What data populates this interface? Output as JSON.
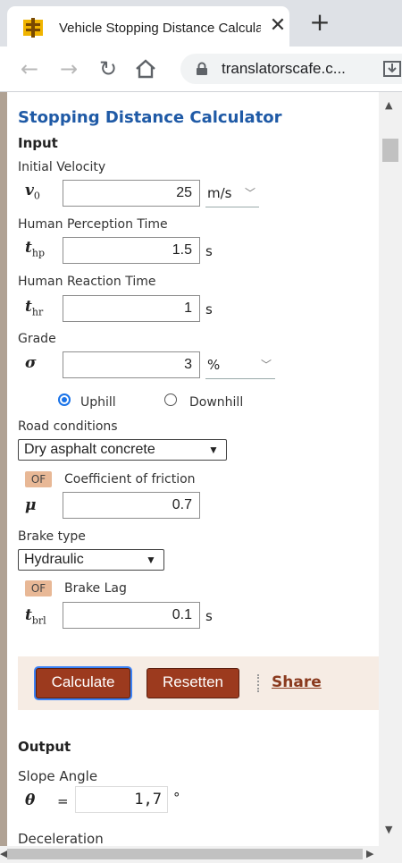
{
  "browser": {
    "tab_title": "Vehicle Stopping Distance Calculator",
    "tab_close": "✕",
    "new_tab": "+",
    "url": "translatorscafe.c...",
    "back": "←",
    "forward": "→",
    "reload": "↻"
  },
  "page": {
    "title": "Stopping Distance Calculator",
    "input_heading": "Input",
    "initial_velocity": {
      "label": "Initial Velocity",
      "symbol": "v",
      "sub": "0",
      "value": "25",
      "unit": "m/s"
    },
    "perception_time": {
      "label": "Human Perception Time",
      "symbol": "t",
      "sub": "hp",
      "value": "1.5",
      "unit": "s"
    },
    "reaction_time": {
      "label": "Human Reaction Time",
      "symbol": "t",
      "sub": "hr",
      "value": "1",
      "unit": "s"
    },
    "grade": {
      "label": "Grade",
      "symbol": "σ",
      "value": "3",
      "unit": "%"
    },
    "direction": {
      "uphill": "Uphill",
      "downhill": "Downhill",
      "selected": "Uphill"
    },
    "road": {
      "label": "Road conditions",
      "value": "Dry asphalt concrete"
    },
    "friction": {
      "badge": "OF",
      "label": "Coefficient of friction",
      "symbol": "μ",
      "value": "0.7"
    },
    "brake": {
      "label": "Brake type",
      "value": "Hydraulic"
    },
    "brake_lag": {
      "badge": "OF",
      "label": "Brake Lag",
      "symbol": "t",
      "sub": "brl",
      "value": "0.1",
      "unit": "s"
    },
    "actions": {
      "calculate": "Calculate",
      "reset": "Resetten",
      "share": "Share"
    },
    "output_heading": "Output",
    "slope": {
      "label": "Slope Angle",
      "symbol": "θ",
      "eq": "=",
      "value": "1,7",
      "unit": "°"
    },
    "deceleration": {
      "label": "Deceleration"
    }
  },
  "colors": {
    "title": "#1f5aa6",
    "button": "#9c3a1e",
    "badge": "#e8b896",
    "actionbar": "#f6ece4"
  }
}
